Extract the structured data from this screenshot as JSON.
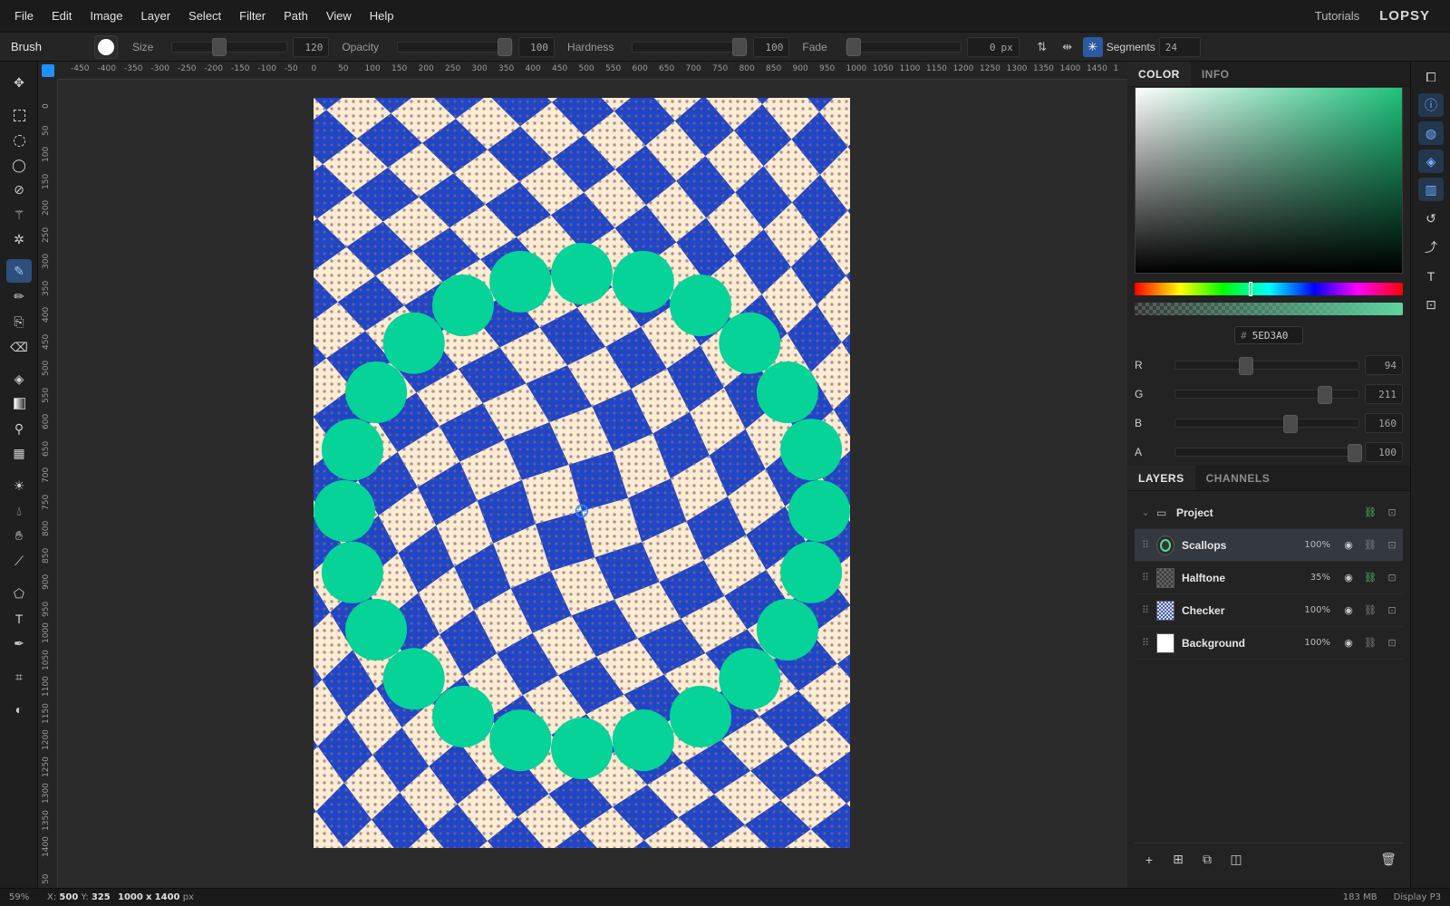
{
  "menu": [
    "File",
    "Edit",
    "Image",
    "Layer",
    "Select",
    "Filter",
    "Path",
    "View",
    "Help"
  ],
  "header": {
    "tutorials": "Tutorials",
    "logo": "LOPSY"
  },
  "tool_options": {
    "tool_name": "Brush",
    "size_label": "Size",
    "size_value": "120",
    "opacity_label": "Opacity",
    "opacity_value": "100",
    "hardness_label": "Hardness",
    "hardness_value": "100",
    "fade_label": "Fade",
    "fade_value": "0",
    "fade_unit": "px",
    "segments_label": "Segments",
    "segments_value": "24"
  },
  "rulers": {
    "top": [
      "-450",
      "-400",
      "-350",
      "-300",
      "-250",
      "-200",
      "-150",
      "-100",
      "-50",
      "0",
      "50",
      "100",
      "150",
      "200",
      "250",
      "300",
      "350",
      "400",
      "450",
      "500",
      "550",
      "600",
      "650",
      "700",
      "750",
      "800",
      "850",
      "900",
      "950",
      "1000",
      "1050",
      "1100",
      "1150",
      "1200",
      "1250",
      "1300",
      "1350",
      "1400",
      "1450",
      "1"
    ],
    "left": [
      "0",
      "50",
      "100",
      "150",
      "200",
      "250",
      "300",
      "350",
      "400",
      "450",
      "500",
      "550",
      "600",
      "650",
      "700",
      "750",
      "800",
      "850",
      "900",
      "950",
      "1000",
      "1050",
      "1100",
      "1150",
      "1200",
      "1250",
      "1300",
      "1350",
      "1400",
      "50"
    ]
  },
  "color_panel": {
    "tabs": [
      "COLOR",
      "INFO"
    ],
    "hex_prefix": "#",
    "hex": "5ED3A0",
    "channels": [
      {
        "label": "R",
        "value": "94",
        "fraction": 0.369
      },
      {
        "label": "G",
        "value": "211",
        "fraction": 0.827
      },
      {
        "label": "B",
        "value": "160",
        "fraction": 0.627
      },
      {
        "label": "A",
        "value": "100",
        "fraction": 1.0
      }
    ],
    "primary_color": "#5ed3a0"
  },
  "layers_panel": {
    "tabs": [
      "LAYERS",
      "CHANNELS"
    ],
    "group": "Project",
    "layers": [
      {
        "name": "Scallops",
        "opacity": "100%",
        "selected": true
      },
      {
        "name": "Halftone",
        "opacity": "35%",
        "selected": false
      },
      {
        "name": "Checker",
        "opacity": "100%",
        "selected": false
      },
      {
        "name": "Background",
        "opacity": "100%",
        "selected": false
      }
    ]
  },
  "status": {
    "zoom": "59%",
    "x_label": "X:",
    "x": "500",
    "y_label": "Y:",
    "y": "325",
    "doc_w": "1000",
    "doc_x": "x",
    "doc_h": "1400",
    "doc_unit": "px",
    "memory": "183 MB",
    "profile": "Display P3"
  },
  "canvas": {
    "checker_blue": "#1f45c9",
    "checker_cream": "#fdebd2",
    "scallop_color": "#05d398",
    "scallop_count": 24
  }
}
